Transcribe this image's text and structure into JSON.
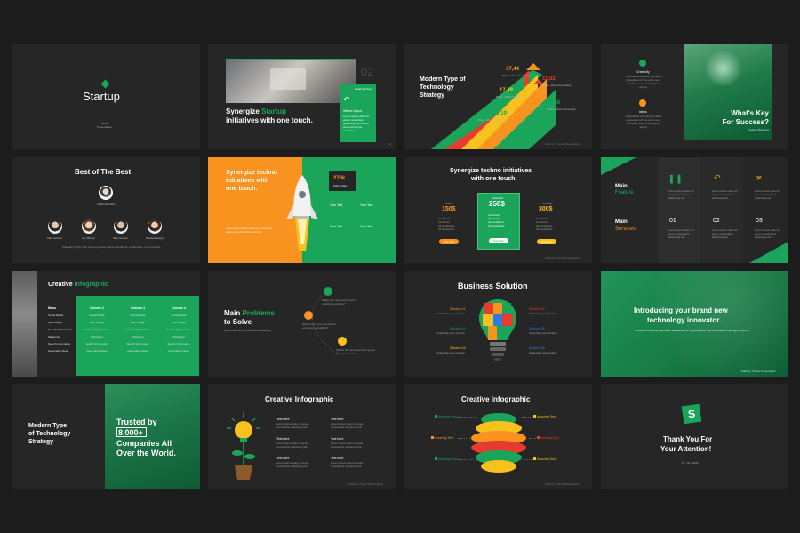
{
  "colors": {
    "background": "#1c1c1c",
    "slide": "#262626",
    "green": "#1aa55a",
    "dark_green": "#0f6b3e",
    "orange": "#f7931e"
  },
  "footer": "Startup | Theme Presentation",
  "s1": {
    "title": "Startup",
    "sub1": "Theme",
    "sub2": "Presentation"
  },
  "s2": {
    "title_a": "Synergize ",
    "title_hl": "Startup",
    "title_b": "initiatives with one touch.",
    "num": "02",
    "card_head": "Read text here",
    "card_title": "Weave layout",
    "card_text": "Lorem ipsum dolor sit amet, consectetur adipiscing elit, sed do eiusmod tempor incididunt."
  },
  "s3": {
    "title1": "Modern Type of",
    "title2": "Technology",
    "title3": "Strategy",
    "stats": [
      {
        "v": "37,44",
        "l": "When, where the beauty"
      },
      {
        "v": "11,82",
        "l": "When, where the beauty"
      },
      {
        "v": "17,49",
        "l": "When, where the beauty"
      },
      {
        "v": "38,10",
        "l": "When, where the beauty"
      },
      {
        "v": "21,19",
        "l": "When, where the beauty"
      }
    ]
  },
  "s4": {
    "items": [
      {
        "title": "Creativity",
        "text": "A wonderful serenity has taken possession of my entire soul, like these sweet mornings of spring."
      },
      {
        "title": "Ideas",
        "text": "A wonderful serenity has taken possession of my entire soul, like these sweet mornings of spring."
      }
    ],
    "title1": "What's Key",
    "title2": "For Success?",
    "sub": "Creative Business"
  },
  "s5": {
    "title": "Best of The Best",
    "ceo": "Charlotte Adam",
    "members": [
      "Mike Gosbel",
      "Lily Mitchel",
      "Mike Gosbel",
      "Madison Hayes"
    ],
    "caption": "Praesent Turpis, Sed cursus pulvinar metus a hendrerit, a bibendum, in non mauris."
  },
  "s6": {
    "title": "Synergize techno initiatives with one touch.",
    "stat": "278k",
    "stat_label": "Active User",
    "texts": [
      "Your Text",
      "Your Text",
      "Your Text",
      "Your Text"
    ],
    "note": "Lorem ipsum dolor sit amet consectetur adipiscing elit sed do eiusmod."
  },
  "s7": {
    "title1": "Synergize techno initiatives",
    "title2": "with one touch.",
    "plans": [
      {
        "name": "Basic",
        "price": "150$"
      },
      {
        "name": "Standard",
        "price": "250$"
      },
      {
        "name": "Ultimate",
        "price": "300$"
      }
    ],
    "features": [
      "For Month",
      "24 Month",
      "24 Conditions",
      "24 Newsletter"
    ],
    "button": "Get Now"
  },
  "s8": {
    "main1": "Main",
    "feature": "Feature",
    "main2": "Main",
    "services": "Services",
    "nums": [
      "01",
      "02",
      "03"
    ],
    "text": "Lorem ipsum dolor sit amet, consectetur adipiscing elit."
  },
  "s9": {
    "title_a": "Creative ",
    "title_b": "Infographic",
    "headers": [
      "Menu",
      "Column 2",
      "Column 3",
      "Column 4"
    ],
    "rows": [
      [
        "Social Media",
        "Social Media",
        "Social Media",
        "Social Media"
      ],
      [
        "Web Design",
        "Web Design",
        "Web Design",
        "Web Design"
      ],
      [
        "Search Optimisation",
        "Search Optimisation",
        "Search Optimisation",
        "Search Optimisation"
      ],
      [
        "Marketing",
        "Marketing",
        "Marketing",
        "Marketing"
      ],
      [
        "Search Information",
        "Search Information",
        "Search Information",
        "Search Information"
      ],
      [
        "Generation Ideas",
        "Generation Ideas",
        "Generation Ideas",
        "Generation Ideas"
      ]
    ]
  },
  "s10": {
    "title_a": "Main ",
    "title_b": "Problems",
    "title_c": "to Solve",
    "sub": "What could be your problem marketing?",
    "items": [
      "What's the most ecommerce marketing problem?",
      "What's the most ecommerce ecommerce problem?",
      "What's the most important you're target audience?"
    ]
  },
  "s11": {
    "title": "Business Solution",
    "solutions": [
      {
        "name": "Solution 01",
        "text": "Customize your content"
      },
      {
        "name": "Solution 02",
        "text": "Customize your content"
      },
      {
        "name": "Solution 03",
        "text": "Customize your content"
      },
      {
        "name": "Solution 04",
        "text": "Customize your content"
      },
      {
        "name": "Solution 05",
        "text": "Customize your content"
      },
      {
        "name": "Solution 06",
        "text": "Customize your content"
      }
    ]
  },
  "s12": {
    "title1": "Introducing your brand new",
    "title2": "technology innovator.",
    "sub": "A wonderful serenity has taken possession of my entire soul, like these sweet mornings of spring."
  },
  "s13": {
    "title1": "Modern Type",
    "title2": "of Technology",
    "title3": "Strategy",
    "trusted": "Trusted by",
    "count": "8,000+",
    "companies1": "Companies All",
    "companies2": "Over the World."
  },
  "s14": {
    "title": "Creative Infographic",
    "items": [
      "Text here",
      "Text here",
      "Text here",
      "Text here",
      "Text here",
      "Text here"
    ],
    "text": "Lorem ipsum dolor sit amet, consectetur adipiscing elit."
  },
  "s15": {
    "title": "Creative Infographic",
    "left": [
      "Amazing Text",
      "Amazing Text",
      "Amazing Text"
    ],
    "right": [
      "Amazing Text",
      "Amazing Text",
      "Amazing Text"
    ]
  },
  "s16": {
    "logo": "S",
    "title1": "Thank You For",
    "title2": "Your Attention!",
    "date": "03 - 02 - 2023"
  }
}
